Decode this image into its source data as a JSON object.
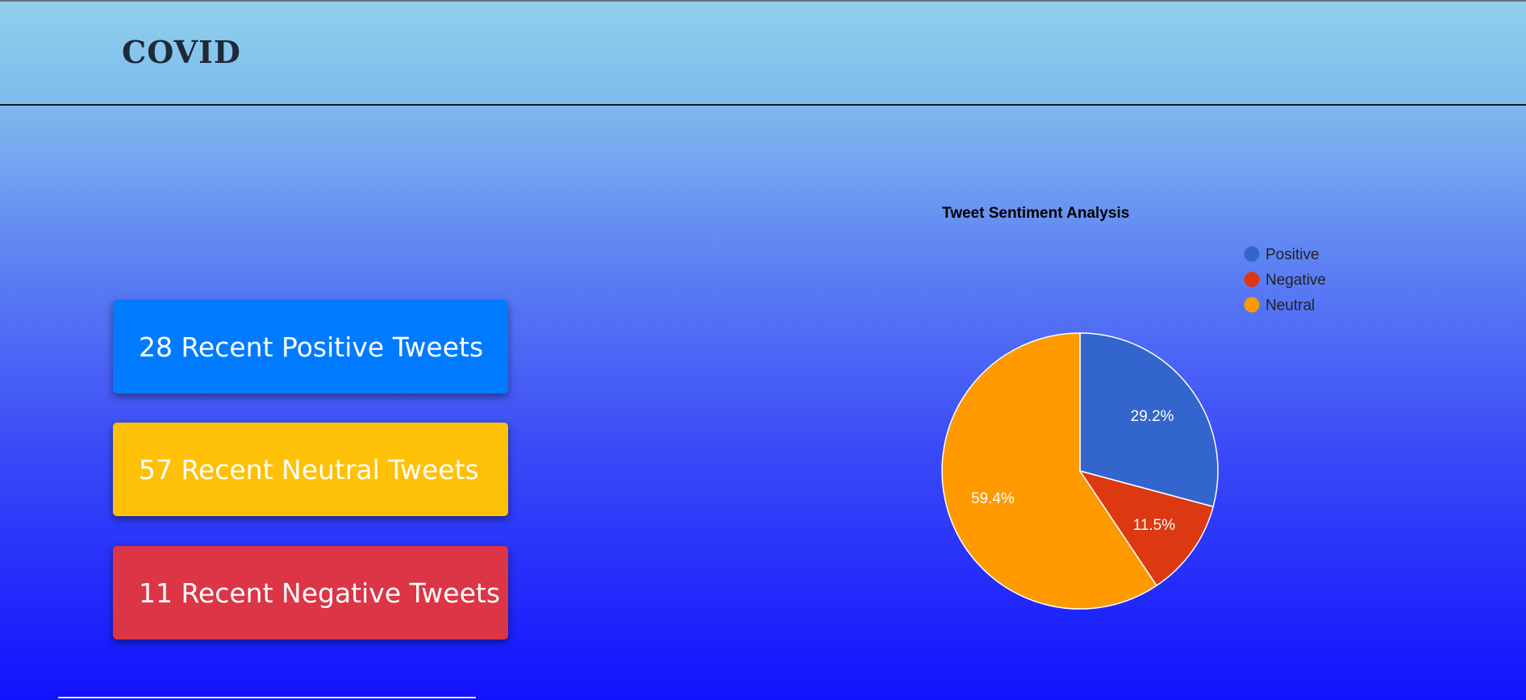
{
  "header": {
    "brand": "COVID"
  },
  "stats": [
    {
      "label": "28 Recent Positive Tweets"
    },
    {
      "label": "57 Recent Neutral Tweets"
    },
    {
      "label": "11 Recent Negative Tweets"
    }
  ],
  "colors": {
    "positive_button": "#007bff",
    "neutral_button": "#ffc107",
    "negative_button": "#dc3545"
  },
  "chart_data": {
    "type": "pie",
    "title": "Tweet Sentiment Analysis",
    "slices": [
      {
        "name": "Positive",
        "value": 28,
        "label": "29.2%",
        "color": "#3366cc"
      },
      {
        "name": "Negative",
        "value": 11,
        "label": "11.5%",
        "color": "#dc3912"
      },
      {
        "name": "Neutral",
        "value": 57,
        "label": "59.4%",
        "color": "#ff9900"
      }
    ],
    "legend_position": "right"
  }
}
